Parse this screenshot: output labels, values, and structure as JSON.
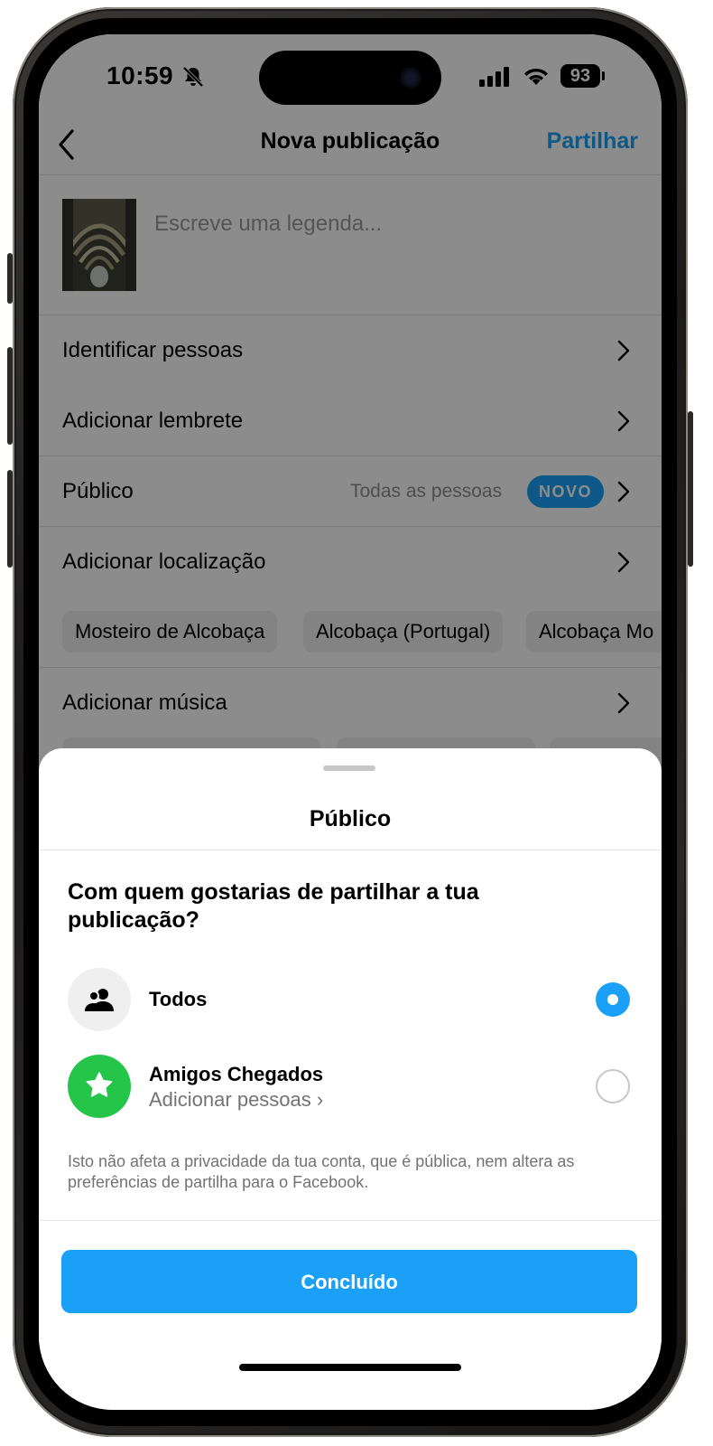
{
  "status_bar": {
    "time": "10:59",
    "battery": "93"
  },
  "nav": {
    "back_icon": "chevron-left-icon",
    "title": "Nova publicação",
    "action": "Partilhar"
  },
  "caption": {
    "placeholder": "Escreve uma legenda..."
  },
  "rows": {
    "tag_people": "Identificar pessoas",
    "reminder": "Adicionar lembrete",
    "audience": {
      "label": "Público",
      "value": "Todas as pessoas",
      "badge": "NOVO"
    },
    "location": "Adicionar localização",
    "music": "Adicionar música"
  },
  "location_chips": [
    "Mosteiro de Alcobaça",
    "Alcobaça (Portugal)",
    "Alcobaça Mo"
  ],
  "sheet": {
    "title": "Público",
    "question": "Com quem gostarias de partilhar a tua publicação?",
    "options": [
      {
        "label": "Todos",
        "icon": "people-icon",
        "selected": true
      },
      {
        "label": "Amigos Chegados",
        "sublabel": "Adicionar pessoas ›",
        "icon": "star-icon",
        "selected": false
      }
    ],
    "note": "Isto não afeta a privacidade da tua conta, que é pública, nem altera as preferências de partilha para o Facebook.",
    "done": "Concluído"
  },
  "colors": {
    "accent": "#1aa1f7",
    "close_friends": "#25c54a"
  }
}
